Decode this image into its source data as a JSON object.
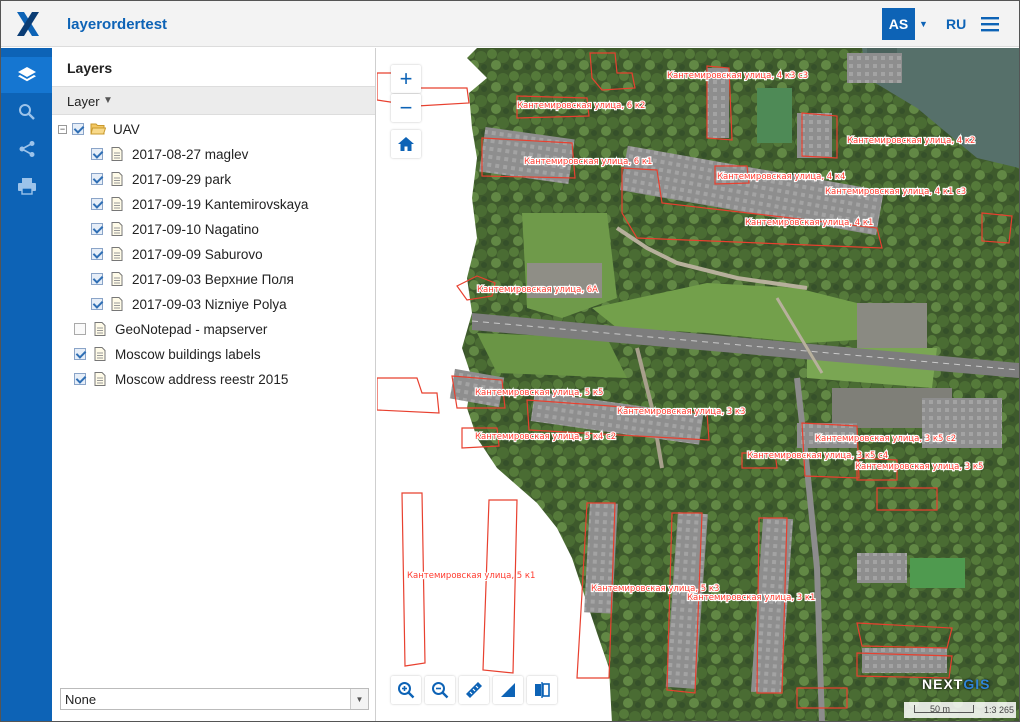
{
  "header": {
    "app_title": "layerordertest",
    "user_initials": "AS",
    "language": "RU",
    "logo_icon": "nextgis-x-logo",
    "menu_icon": "hamburger-icon"
  },
  "rail": {
    "items": [
      {
        "name": "layers",
        "icon": "layers-icon",
        "active": true
      },
      {
        "name": "search",
        "icon": "search-icon",
        "active": false
      },
      {
        "name": "share",
        "icon": "share-icon",
        "active": false
      },
      {
        "name": "print",
        "icon": "print-icon",
        "active": false
      }
    ]
  },
  "panel": {
    "title": "Layers",
    "column_label": "Layer",
    "tree": {
      "group_label": "UAV",
      "children": [
        "2017-08-27 maglev",
        "2017-09-29 park",
        "2017-09-19 Kantemirovskaya",
        "2017-09-10 Nagatino",
        "2017-09-09 Saburovo",
        "2017-09-03 Верхние Поля",
        "2017-09-03 Nizniye Polya"
      ],
      "top_layers": [
        {
          "label": "GeoNotepad - mapserver",
          "checked": false
        },
        {
          "label": "Moscow buildings labels",
          "checked": true
        },
        {
          "label": "Moscow address reestr 2015",
          "checked": true
        }
      ]
    },
    "basemap_select": "None"
  },
  "map": {
    "zoom_in": "+",
    "zoom_out": "−",
    "brand": {
      "prefix": "NEXT",
      "suffix": "GIS"
    },
    "scale_label": "50 m",
    "scale_ratio": "1:3 265",
    "labels": [
      "Кантемировская улица, 4 к3 с3",
      "Кантемировская улица, 6 к2",
      "Кантемировская улица, 4 к2",
      "Кантемировская улица, 6 к1",
      "Кантемировская улица, 4 к4",
      "Кантемировская улица, 4 к1 с3",
      "Кантемировская улица, 4 к1",
      "Кантемировская улица, 6А",
      "Кантемировская улица, 5 к5",
      "Кантемировская улица, 3 к3",
      "Кантемировская улица, 5 к4 с2",
      "Кантемировская улица, 3 к5 с2",
      "Кантемировская улица, 3 к5 с4",
      "Кантемировская улица, 3 к5",
      "Кантемировская улица, 5 к1",
      "Кантемировская улица, 5 к3",
      "Кантемировская улица, 3 к1"
    ]
  },
  "colors": {
    "brand_blue": "#0d63b6",
    "outline_red": "#e8402f",
    "label_red": "#ff3b2f"
  }
}
